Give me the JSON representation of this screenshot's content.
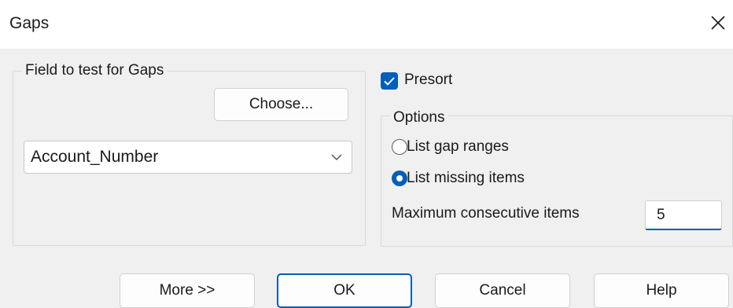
{
  "window": {
    "title": "Gaps",
    "close_icon": "close-icon"
  },
  "field_group": {
    "legend": "Field to test for Gaps",
    "choose_label": "Choose...",
    "field_value": "Account_Number",
    "dropdown_icon": "chevron-down-icon"
  },
  "presort": {
    "label": "Presort",
    "checked": true
  },
  "options_group": {
    "legend": "Options",
    "list_gap_ranges_label": "List gap ranges",
    "list_gap_ranges_selected": false,
    "list_missing_items_label": "List missing items",
    "list_missing_items_selected": true,
    "max_consecutive_label": "Maximum consecutive items",
    "max_consecutive_value": "5"
  },
  "buttons": {
    "more": "More >>",
    "ok": "OK",
    "cancel": "Cancel",
    "help": "Help"
  },
  "colors": {
    "accent": "#005fb8",
    "client_background": "#f0f0f0"
  }
}
